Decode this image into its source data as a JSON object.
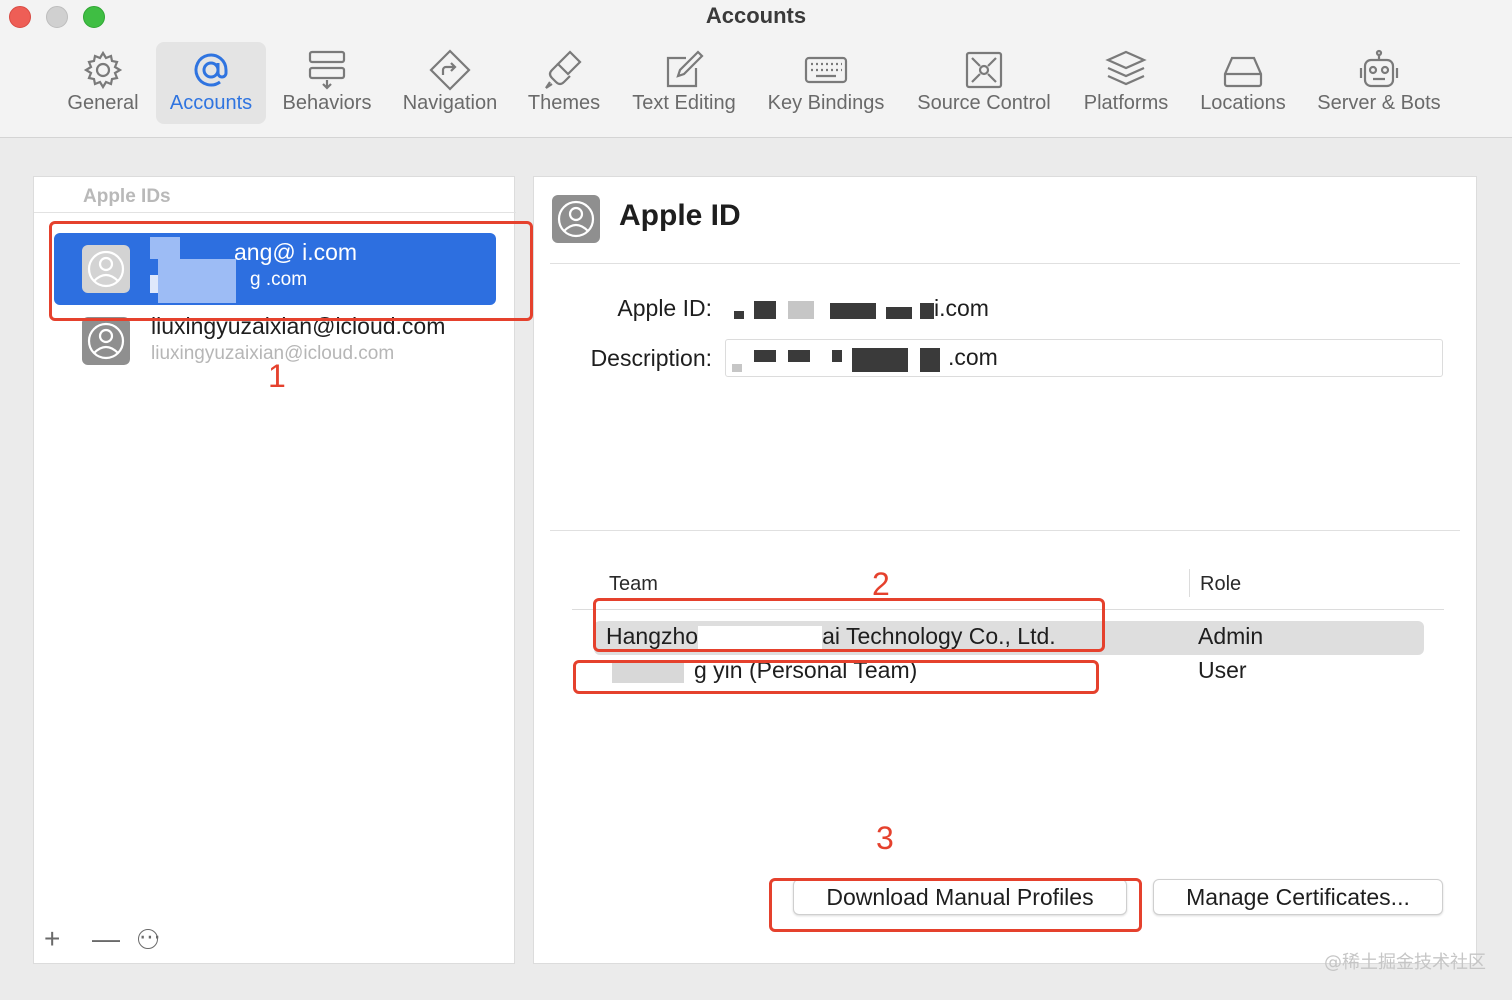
{
  "window": {
    "title": "Accounts"
  },
  "toolbar": {
    "items": [
      {
        "label": "General",
        "icon": "gear-icon"
      },
      {
        "label": "Accounts",
        "icon": "at-sign-icon",
        "active": true
      },
      {
        "label": "Behaviors",
        "icon": "behaviors-icon"
      },
      {
        "label": "Navigation",
        "icon": "navigation-icon"
      },
      {
        "label": "Themes",
        "icon": "brush-icon"
      },
      {
        "label": "Text Editing",
        "icon": "pencil-square-icon"
      },
      {
        "label": "Key Bindings",
        "icon": "keyboard-icon"
      },
      {
        "label": "Source Control",
        "icon": "source-control-icon"
      },
      {
        "label": "Platforms",
        "icon": "layers-icon"
      },
      {
        "label": "Locations",
        "icon": "drive-icon"
      },
      {
        "label": "Server & Bots",
        "icon": "robot-icon"
      }
    ]
  },
  "sidebar": {
    "header": "Apple IDs",
    "accounts": [
      {
        "primary": "ang@ i.com",
        "secondary": "g .com",
        "selected": true
      },
      {
        "primary": "liuxingyuzaixian@icloud.com",
        "secondary": "liuxingyuzaixian@icloud.com",
        "selected": false
      }
    ],
    "footer": {
      "add": "+",
      "remove": "—",
      "more": "⋯"
    }
  },
  "detail": {
    "title": "Apple ID",
    "apple_id_label": "Apple ID:",
    "apple_id_value_suffix": "i.com",
    "description_label": "Description:",
    "description_value_suffix": ".com",
    "teams": {
      "headers": {
        "team": "Team",
        "role": "Role"
      },
      "rows": [
        {
          "team_prefix": "Hangzho",
          "team_suffix": "ai Technology Co., Ltd.",
          "role": "Admin",
          "selected": true
        },
        {
          "team_prefix": "",
          "team_suffix": "g yin (Personal Team)",
          "role": "User",
          "selected": false
        }
      ]
    },
    "buttons": {
      "download": "Download Manual Profiles",
      "manage": "Manage Certificates..."
    }
  },
  "annotations": {
    "n1": "1",
    "n2": "2",
    "n3": "3",
    "color": "#e5412d"
  },
  "watermark": "@稀土掘金技术社区"
}
